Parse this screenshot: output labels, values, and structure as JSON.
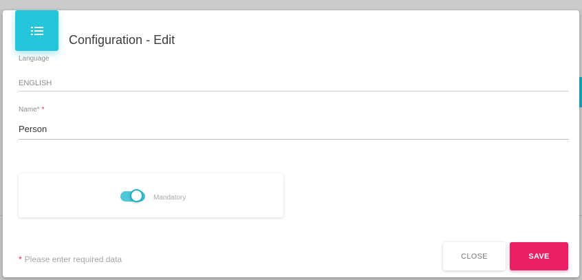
{
  "dialog": {
    "title": "Configuration - Edit"
  },
  "fields": {
    "language": {
      "label": "Language",
      "value": "ENGLISH"
    },
    "name": {
      "label": "Name*",
      "required_marker": "*",
      "value": "Person"
    }
  },
  "toggle": {
    "label": "Mandatory",
    "state": "on"
  },
  "footer": {
    "required_marker": "*",
    "hint": "Please enter required data",
    "close_label": "CLOSE",
    "save_label": "SAVE"
  },
  "colors": {
    "header_accent": "#26c6da",
    "save_button": "#e91e63",
    "toggle_on": "#4fc9d8"
  }
}
